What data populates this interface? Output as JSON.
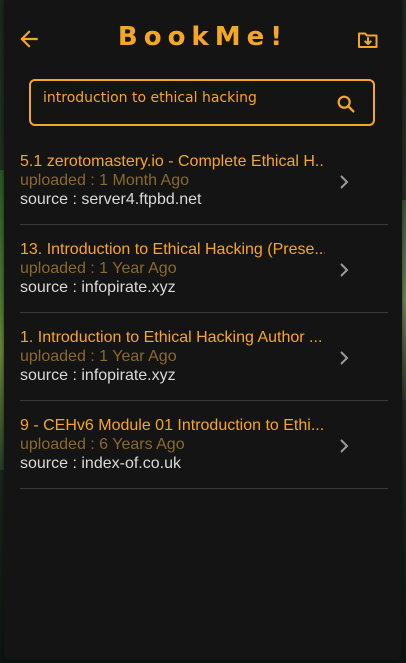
{
  "app": {
    "title": "BookMe!",
    "accent_color": "#f5a623",
    "background_color": "#141414",
    "back_icon": "arrow-left-icon",
    "folder_icon": "folder-download-icon"
  },
  "search": {
    "value": "introduction to ethical hacking",
    "icon": "search-icon"
  },
  "results": [
    {
      "title": "5.1 zerotomastery.io - Complete Ethical H...",
      "uploaded": "uploaded : 1 Month Ago",
      "source": "source : server4.ftpbd.net"
    },
    {
      "title": "13. Introduction to Ethical Hacking (Prese...",
      "uploaded": "uploaded : 1 Year Ago",
      "source": "source : infopirate.xyz"
    },
    {
      "title": "1. Introduction to Ethical Hacking Author ...",
      "uploaded": "uploaded : 1 Year Ago",
      "source": "source : infopirate.xyz"
    },
    {
      "title": "9 - CEHv6 Module 01 Introduction to Ethi...",
      "uploaded": "uploaded : 6 Years Ago",
      "source": "source : index-of.co.uk"
    }
  ]
}
